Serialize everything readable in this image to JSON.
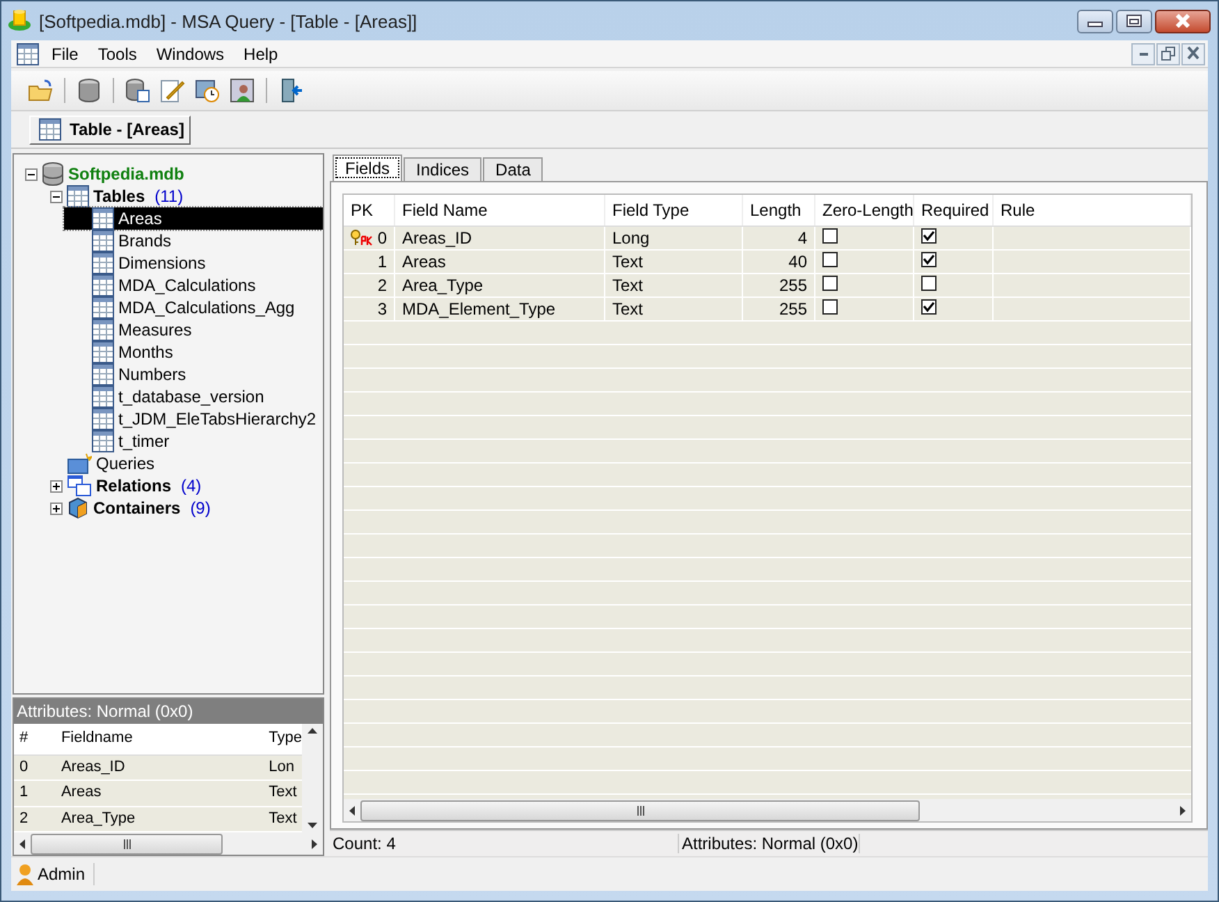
{
  "window": {
    "title": "[Softpedia.mdb] - MSA Query - [Table - [Areas]]"
  },
  "menu": [
    "File",
    "Tools",
    "Windows",
    "Help"
  ],
  "document_tab": {
    "label": "Table - [Areas]"
  },
  "tree": [
    {
      "label": "Softpedia.mdb",
      "kind": "database",
      "expanded": true,
      "children": [
        {
          "label": "Tables",
          "count": "(11)",
          "kind": "tables",
          "expanded": true,
          "children": [
            {
              "label": "Areas",
              "kind": "table",
              "selected": true
            },
            {
              "label": "Brands",
              "kind": "table",
              "selected": false
            },
            {
              "label": "Dimensions",
              "kind": "table",
              "selected": false
            },
            {
              "label": "MDA_Calculations",
              "kind": "table",
              "selected": false
            },
            {
              "label": "MDA_Calculations_Agg",
              "kind": "table",
              "selected": false
            },
            {
              "label": "Measures",
              "kind": "table",
              "selected": false
            },
            {
              "label": "Months",
              "kind": "table",
              "selected": false
            },
            {
              "label": "Numbers",
              "kind": "table",
              "selected": false
            },
            {
              "label": "t_database_version",
              "kind": "table",
              "selected": false
            },
            {
              "label": "t_JDM_EleTabsHierarchy2",
              "kind": "table",
              "selected": false
            },
            {
              "label": "t_timer",
              "kind": "table",
              "selected": false
            }
          ]
        },
        {
          "label": "Queries",
          "kind": "queries"
        },
        {
          "label": "Relations",
          "count": "(4)",
          "kind": "relations",
          "expanded": false
        },
        {
          "label": "Containers",
          "count": "(9)",
          "kind": "containers",
          "expanded": false
        }
      ]
    }
  ],
  "attributes_panel": {
    "title": "Attributes: Normal (0x0)",
    "columns": [
      "#",
      "Fieldname",
      "Type"
    ],
    "rows": [
      [
        "0",
        "Areas_ID",
        "Lon"
      ],
      [
        "1",
        "Areas",
        "Text"
      ],
      [
        "2",
        "Area_Type",
        "Text"
      ]
    ]
  },
  "tabs": [
    {
      "label": "Fields",
      "selected": true
    },
    {
      "label": "Indices",
      "selected": false
    },
    {
      "label": "Data",
      "selected": false
    }
  ],
  "fields_table": {
    "columns": [
      "PK",
      "Field Name",
      "Field Type",
      "Length",
      "Zero-Length",
      "Required",
      "Rule"
    ],
    "rows": [
      {
        "pk": true,
        "index": "0",
        "name": "Areas_ID",
        "type": "Long",
        "length": "4",
        "zero_length": false,
        "required": true
      },
      {
        "pk": false,
        "index": "1",
        "name": "Areas",
        "type": "Text",
        "length": "40",
        "zero_length": false,
        "required": true
      },
      {
        "pk": false,
        "index": "2",
        "name": "Area_Type",
        "type": "Text",
        "length": "255",
        "zero_length": false,
        "required": false
      },
      {
        "pk": false,
        "index": "3",
        "name": "MDA_Element_Type",
        "type": "Text",
        "length": "255",
        "zero_length": false,
        "required": true
      }
    ]
  },
  "status_bar": [
    "Count: 4",
    "Attributes: Normal (0x0)"
  ],
  "user_bar": {
    "user": "Admin"
  }
}
